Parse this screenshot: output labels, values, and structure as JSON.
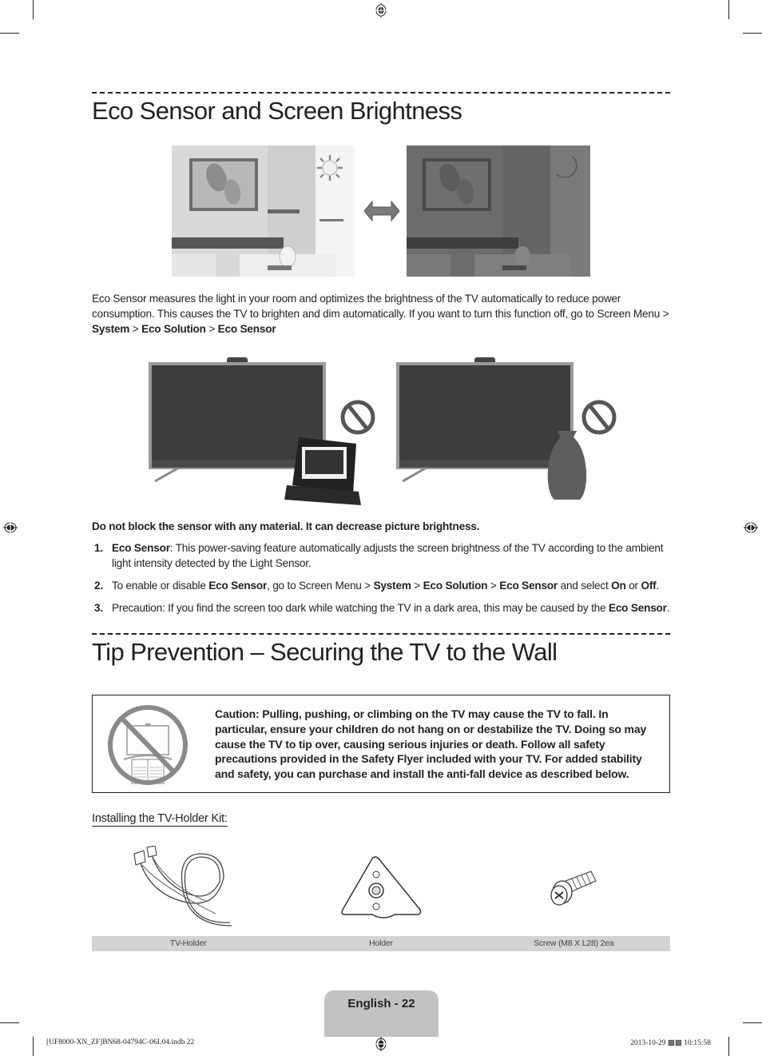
{
  "section1": {
    "title": "Eco Sensor and Screen Brightness",
    "images": {
      "bright_room_icon": "sun-icon",
      "dark_room_icon": "moon-icon",
      "arrow_icon": "double-arrow-icon"
    },
    "intro_prefix": "Eco Sensor measures the light in your room and optimizes the brightness of the TV automatically to reduce power consumption. This causes the TV to brighten and dim automatically. If you want to turn this function off, go to Screen Menu > ",
    "intro_path": [
      "System",
      "Eco Solution",
      "Eco Sensor"
    ],
    "path_separator": " > ",
    "warning": "Do not block the sensor with any material. It can decrease picture brightness.",
    "list": [
      {
        "num": "1.",
        "bold_lead": "Eco Sensor",
        "text": ": This power-saving feature automatically adjusts the screen brightness of the TV according to the ambient light intensity detected by the Light Sensor."
      },
      {
        "num": "2.",
        "parts": {
          "a": "To enable or disable ",
          "b": "Eco Sensor",
          "c": ", go to Screen Menu > ",
          "d": "System",
          "e": " > ",
          "f": "Eco Solution",
          "g": " > ",
          "h": "Eco Sensor",
          "i": " and select ",
          "j": "On",
          "k": " or ",
          "l": "Off",
          "m": "."
        }
      },
      {
        "num": "3.",
        "text": "Precaution: If you find the screen too dark while watching the TV in a dark area, this may be caused by the ",
        "bold_tail": "Eco Sensor",
        "end": "."
      }
    ]
  },
  "section2": {
    "title": "Tip Prevention – Securing the TV to the Wall",
    "caution": "Caution: Pulling, pushing, or climbing on the TV may cause the TV to fall. In particular, ensure your children do not hang on or destabilize the TV. Doing so may cause the TV to tip over, causing serious injuries or death. Follow all safety precautions provided in the Safety Flyer included with your TV. For added stability and safety, you can purchase and install the anti-fall device as described below.",
    "kit_heading": "Installing the TV-Holder Kit:",
    "kit_items": [
      "TV-Holder",
      "Holder",
      "Screw (M8 X L28) 2ea"
    ]
  },
  "footer": {
    "page_label": "English - 22",
    "file_info": "[UF8000-XN_ZF]BN68-04794C-06L04.indb   22",
    "timestamp": "2013-10-29   ▩▩ 10:15:58"
  }
}
